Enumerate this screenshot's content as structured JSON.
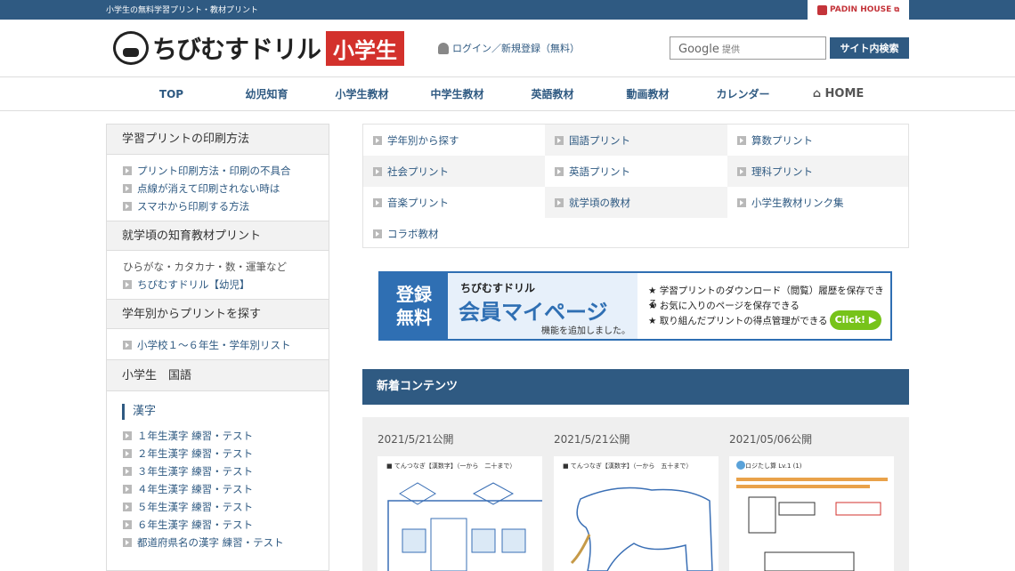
{
  "topbar": {
    "tagline": "小学生の無料学習プリント・教材プリント",
    "partner": "PADIN HOUSE"
  },
  "header": {
    "logo_text": "ちびむすドリル",
    "logo_badge": "小学生",
    "login": "ログイン／新規登録（無料）",
    "search_brand": "Google",
    "search_placeholder": "提供",
    "search_button": "サイト内検索"
  },
  "nav": [
    "TOP",
    "幼児知育",
    "小学生教材",
    "中学生教材",
    "英語教材",
    "動画教材",
    "カレンダー",
    "HOME"
  ],
  "sidebar": {
    "sections": [
      {
        "title": "学習プリントの印刷方法",
        "items": [
          "プリント印刷方法・印刷の不具合",
          "点線が消えて印刷されない時は",
          "スマホから印刷する方法"
        ]
      },
      {
        "title": "就学頃の知育教材プリント",
        "note": "ひらがな・カタカナ・数・運筆など",
        "items": [
          "ちびむすドリル【幼児】"
        ]
      },
      {
        "title": "学年別からプリントを探す",
        "items": [
          "小学校１〜６年生・学年別リスト"
        ]
      },
      {
        "title": "小学生　国語",
        "subhead": "漢字",
        "items": [
          "１年生漢字 練習・テスト",
          "２年生漢字 練習・テスト",
          "３年生漢字 練習・テスト",
          "４年生漢字 練習・テスト",
          "５年生漢字 練習・テスト",
          "６年生漢字 練習・テスト",
          "都道府県名の漢字 練習・テスト"
        ]
      }
    ]
  },
  "categories": [
    "学年別から探す",
    "国語プリント",
    "算数プリント",
    "社会プリント",
    "英語プリント",
    "理科プリント",
    "音楽プリント",
    "就学頃の教材",
    "小学生教材リンク集",
    "コラボ教材"
  ],
  "banner": {
    "left": [
      "登録",
      "無料"
    ],
    "brand": "ちびむすドリル",
    "title": "会員マイページ",
    "sub": "機能を追加しました。",
    "points": [
      "★ 学習プリントのダウンロード（閲覧）履歴を保存できる",
      "★ お気に入りのページを保存できる",
      "★ 取り組んだプリントの得点管理ができる"
    ],
    "click": "Click! ▶"
  },
  "news": {
    "title": "新着コンテンツ",
    "items": [
      {
        "date": "2021/5/21公開",
        "caption": "■ てんつなぎ【漢数字】（一から　二十まで）"
      },
      {
        "date": "2021/5/21公開",
        "caption": "■ てんつなぎ【漢数字】（一から　五十まで）"
      },
      {
        "date": "2021/05/06公開",
        "caption": "ロジたし算 Lv.1 (1)"
      }
    ]
  }
}
